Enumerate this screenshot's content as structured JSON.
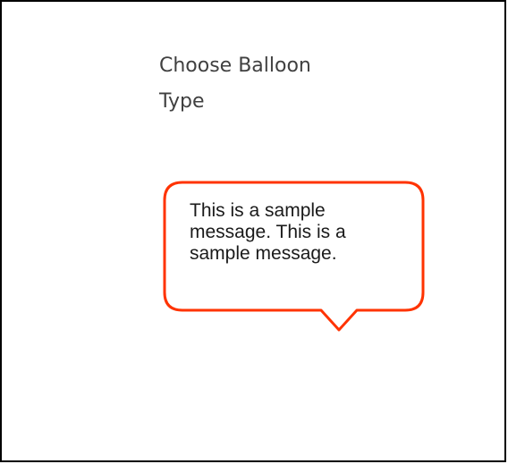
{
  "heading": {
    "line1": "Choose Balloon",
    "line2": "Type"
  },
  "balloon": {
    "line1": "This is a sample",
    "line2": "message. This is a",
    "line3": "sample message.",
    "border_color": "#ff3300"
  }
}
